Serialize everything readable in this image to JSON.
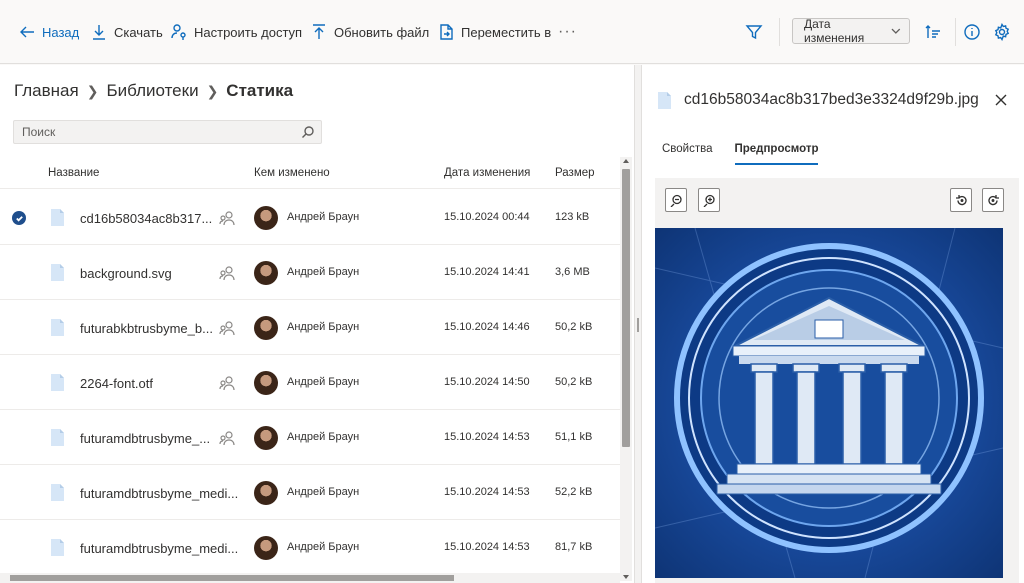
{
  "toolbar": {
    "back_label": "Назад",
    "download_label": "Скачать",
    "share_label": "Настроить доступ",
    "update_label": "Обновить файл",
    "move_label": "Переместить в",
    "more_label": "···",
    "sort_label": "Дата изменения"
  },
  "breadcrumb": {
    "home": "Главная",
    "libraries": "Библиотеки",
    "current": "Статика"
  },
  "search": {
    "placeholder": "Поиск"
  },
  "table": {
    "headers": {
      "name": "Название",
      "modified_by": "Кем изменено",
      "modified": "Дата изменения",
      "size": "Размер"
    },
    "rows": [
      {
        "name": "cd16b58034ac8b317...",
        "modified_by": "Андрей Браун",
        "modified": "15.10.2024 00:44",
        "size": "123 kB",
        "selected": true
      },
      {
        "name": "background.svg",
        "modified_by": "Андрей Браун",
        "modified": "15.10.2024 14:41",
        "size": "3,6 MB",
        "selected": false
      },
      {
        "name": "futurabkbtrusbyme_b...",
        "modified_by": "Андрей Браун",
        "modified": "15.10.2024 14:46",
        "size": "50,2 kB",
        "selected": false
      },
      {
        "name": "2264-font.otf",
        "modified_by": "Андрей Браун",
        "modified": "15.10.2024 14:50",
        "size": "50,2 kB",
        "selected": false
      },
      {
        "name": "futuramdbtrusbyme_...",
        "modified_by": "Андрей Браун",
        "modified": "15.10.2024 14:53",
        "size": "51,1 kB",
        "selected": false
      },
      {
        "name": "futuramdbtrusbyme_medi...",
        "modified_by": "Андрей Браун",
        "modified": "15.10.2024 14:53",
        "size": "52,2 kB",
        "selected": false
      },
      {
        "name": "futuramdbtrusbyme_medi...",
        "modified_by": "Андрей Браун",
        "modified": "15.10.2024 14:53",
        "size": "81,7 kB",
        "selected": false
      }
    ]
  },
  "details": {
    "filename": "cd16b58034ac8b317bed3e3324d9f29b.jpg",
    "tabs": {
      "properties": "Свойства",
      "preview": "Предпросмотр"
    }
  },
  "colors": {
    "accent": "#0f6cbd",
    "selected_check": "#1f4e8c",
    "preview_blue": "#1b4fa6"
  }
}
